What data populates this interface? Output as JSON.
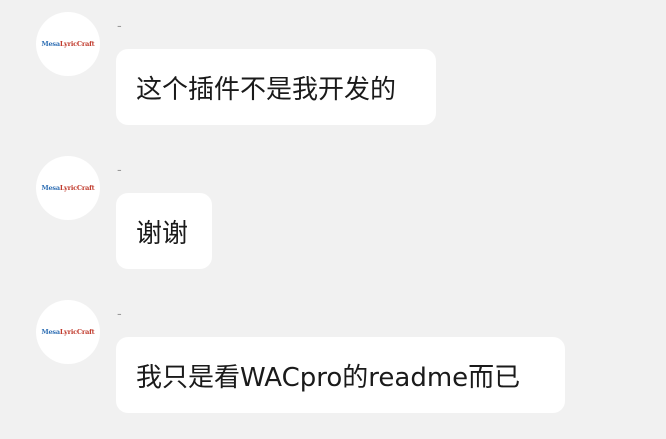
{
  "messages": [
    {
      "sender": "-",
      "avatar_logo_left": "Mesa",
      "avatar_logo_right": "LyricCraft",
      "text": "这个插件不是我开发的"
    },
    {
      "sender": "-",
      "avatar_logo_left": "Mesa",
      "avatar_logo_right": "LyricCraft",
      "text": "谢谢"
    },
    {
      "sender": "-",
      "avatar_logo_left": "Mesa",
      "avatar_logo_right": "LyricCraft",
      "text": "我只是看WACpro的readme而已"
    }
  ],
  "colors": {
    "background": "#f1f1f1",
    "bubble": "#ffffff",
    "logo_blue": "#2f6fb4",
    "logo_red": "#c0392b"
  }
}
